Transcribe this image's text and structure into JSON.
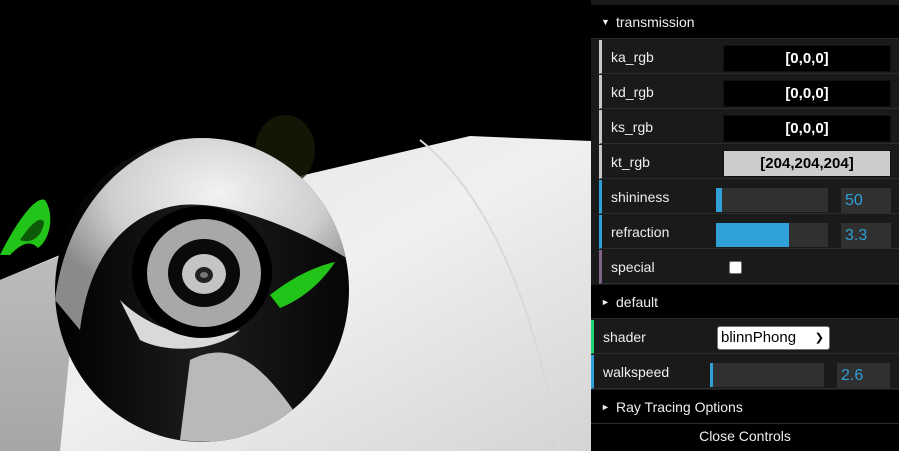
{
  "gui": {
    "transmission": {
      "title": "transmission",
      "ka_rgb": {
        "label": "ka_rgb",
        "value": "[0,0,0]",
        "swatch_color": "#000000"
      },
      "kd_rgb": {
        "label": "kd_rgb",
        "value": "[0,0,0]",
        "swatch_color": "#000000"
      },
      "ks_rgb": {
        "label": "ks_rgb",
        "value": "[0,0,0]",
        "swatch_color": "#000000"
      },
      "kt_rgb": {
        "label": "kt_rgb",
        "value": "[204,204,204]",
        "swatch_color": "#cccccc"
      },
      "shininess": {
        "label": "shininess",
        "value": "50",
        "fill_fraction": 0.05
      },
      "refraction": {
        "label": "refraction",
        "value": "3.3",
        "fill_fraction": 0.65
      },
      "special": {
        "label": "special",
        "checked": false
      }
    },
    "default": {
      "title": "default",
      "shader": {
        "label": "shader",
        "selected": "blinnPhong"
      },
      "walkspeed": {
        "label": "walkspeed",
        "value": "2.6",
        "fill_fraction": 0.03
      }
    },
    "ray_tracing": {
      "title": "Ray Tracing Options"
    },
    "close_label": "Close Controls"
  },
  "colors": {
    "accent": "#2fa1d6",
    "panel_bg": "#1a1a1a",
    "title_bg": "#000000",
    "scene_green": "#22c41a"
  }
}
